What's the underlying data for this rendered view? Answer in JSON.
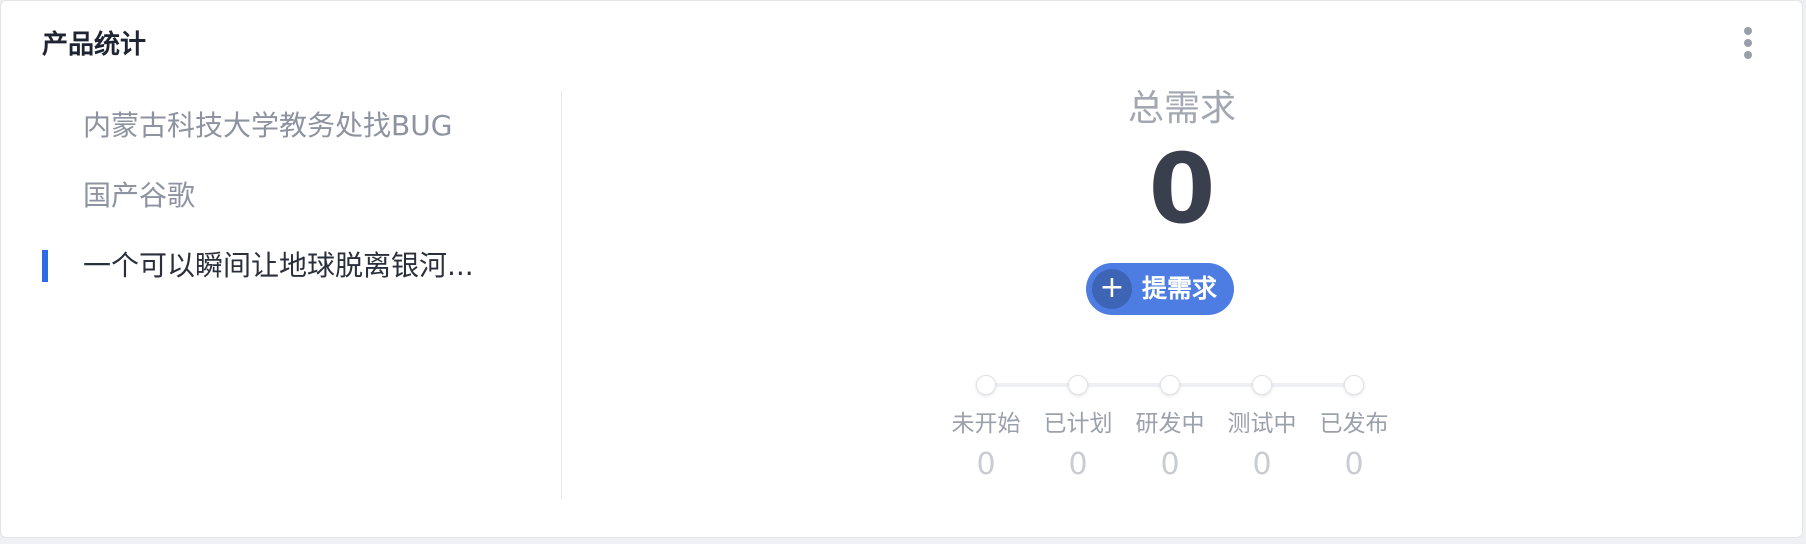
{
  "card": {
    "title": "产品统计",
    "more_icon": "more-vertical-icon"
  },
  "products": [
    {
      "name": "内蒙古科技大学教务处找BUG",
      "active": false
    },
    {
      "name": "国产谷歌",
      "active": false
    },
    {
      "name": "一个可以瞬间让地球脱离银河...",
      "active": true
    }
  ],
  "summary": {
    "label": "总需求",
    "value": "0",
    "add_button": {
      "icon": "plus-icon",
      "symbol": "+",
      "label": "提需求"
    }
  },
  "stages": [
    {
      "label": "未开始",
      "count": "0"
    },
    {
      "label": "已计划",
      "count": "0"
    },
    {
      "label": "研发中",
      "count": "0"
    },
    {
      "label": "测试中",
      "count": "0"
    },
    {
      "label": "已发布",
      "count": "0"
    }
  ],
  "colors": {
    "accent": "#2e6be6",
    "button": "#4d7de2",
    "button_icon_bg": "#3e64b6"
  }
}
